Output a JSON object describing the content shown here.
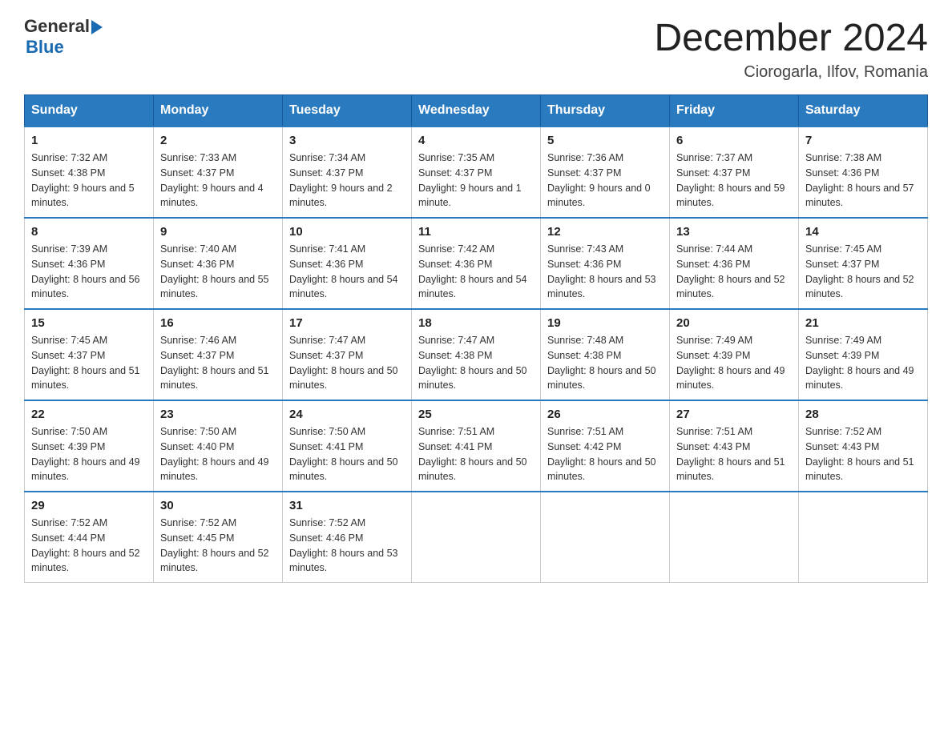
{
  "header": {
    "logo_general": "General",
    "logo_blue": "Blue",
    "title": "December 2024",
    "location": "Ciorogarla, Ilfov, Romania"
  },
  "days_of_week": [
    "Sunday",
    "Monday",
    "Tuesday",
    "Wednesday",
    "Thursday",
    "Friday",
    "Saturday"
  ],
  "weeks": [
    [
      {
        "day": "1",
        "sunrise": "7:32 AM",
        "sunset": "4:38 PM",
        "daylight": "9 hours and 5 minutes."
      },
      {
        "day": "2",
        "sunrise": "7:33 AM",
        "sunset": "4:37 PM",
        "daylight": "9 hours and 4 minutes."
      },
      {
        "day": "3",
        "sunrise": "7:34 AM",
        "sunset": "4:37 PM",
        "daylight": "9 hours and 2 minutes."
      },
      {
        "day": "4",
        "sunrise": "7:35 AM",
        "sunset": "4:37 PM",
        "daylight": "9 hours and 1 minute."
      },
      {
        "day": "5",
        "sunrise": "7:36 AM",
        "sunset": "4:37 PM",
        "daylight": "9 hours and 0 minutes."
      },
      {
        "day": "6",
        "sunrise": "7:37 AM",
        "sunset": "4:37 PM",
        "daylight": "8 hours and 59 minutes."
      },
      {
        "day": "7",
        "sunrise": "7:38 AM",
        "sunset": "4:36 PM",
        "daylight": "8 hours and 57 minutes."
      }
    ],
    [
      {
        "day": "8",
        "sunrise": "7:39 AM",
        "sunset": "4:36 PM",
        "daylight": "8 hours and 56 minutes."
      },
      {
        "day": "9",
        "sunrise": "7:40 AM",
        "sunset": "4:36 PM",
        "daylight": "8 hours and 55 minutes."
      },
      {
        "day": "10",
        "sunrise": "7:41 AM",
        "sunset": "4:36 PM",
        "daylight": "8 hours and 54 minutes."
      },
      {
        "day": "11",
        "sunrise": "7:42 AM",
        "sunset": "4:36 PM",
        "daylight": "8 hours and 54 minutes."
      },
      {
        "day": "12",
        "sunrise": "7:43 AM",
        "sunset": "4:36 PM",
        "daylight": "8 hours and 53 minutes."
      },
      {
        "day": "13",
        "sunrise": "7:44 AM",
        "sunset": "4:36 PM",
        "daylight": "8 hours and 52 minutes."
      },
      {
        "day": "14",
        "sunrise": "7:45 AM",
        "sunset": "4:37 PM",
        "daylight": "8 hours and 52 minutes."
      }
    ],
    [
      {
        "day": "15",
        "sunrise": "7:45 AM",
        "sunset": "4:37 PM",
        "daylight": "8 hours and 51 minutes."
      },
      {
        "day": "16",
        "sunrise": "7:46 AM",
        "sunset": "4:37 PM",
        "daylight": "8 hours and 51 minutes."
      },
      {
        "day": "17",
        "sunrise": "7:47 AM",
        "sunset": "4:37 PM",
        "daylight": "8 hours and 50 minutes."
      },
      {
        "day": "18",
        "sunrise": "7:47 AM",
        "sunset": "4:38 PM",
        "daylight": "8 hours and 50 minutes."
      },
      {
        "day": "19",
        "sunrise": "7:48 AM",
        "sunset": "4:38 PM",
        "daylight": "8 hours and 50 minutes."
      },
      {
        "day": "20",
        "sunrise": "7:49 AM",
        "sunset": "4:39 PM",
        "daylight": "8 hours and 49 minutes."
      },
      {
        "day": "21",
        "sunrise": "7:49 AM",
        "sunset": "4:39 PM",
        "daylight": "8 hours and 49 minutes."
      }
    ],
    [
      {
        "day": "22",
        "sunrise": "7:50 AM",
        "sunset": "4:39 PM",
        "daylight": "8 hours and 49 minutes."
      },
      {
        "day": "23",
        "sunrise": "7:50 AM",
        "sunset": "4:40 PM",
        "daylight": "8 hours and 49 minutes."
      },
      {
        "day": "24",
        "sunrise": "7:50 AM",
        "sunset": "4:41 PM",
        "daylight": "8 hours and 50 minutes."
      },
      {
        "day": "25",
        "sunrise": "7:51 AM",
        "sunset": "4:41 PM",
        "daylight": "8 hours and 50 minutes."
      },
      {
        "day": "26",
        "sunrise": "7:51 AM",
        "sunset": "4:42 PM",
        "daylight": "8 hours and 50 minutes."
      },
      {
        "day": "27",
        "sunrise": "7:51 AM",
        "sunset": "4:43 PM",
        "daylight": "8 hours and 51 minutes."
      },
      {
        "day": "28",
        "sunrise": "7:52 AM",
        "sunset": "4:43 PM",
        "daylight": "8 hours and 51 minutes."
      }
    ],
    [
      {
        "day": "29",
        "sunrise": "7:52 AM",
        "sunset": "4:44 PM",
        "daylight": "8 hours and 52 minutes."
      },
      {
        "day": "30",
        "sunrise": "7:52 AM",
        "sunset": "4:45 PM",
        "daylight": "8 hours and 52 minutes."
      },
      {
        "day": "31",
        "sunrise": "7:52 AM",
        "sunset": "4:46 PM",
        "daylight": "8 hours and 53 minutes."
      },
      null,
      null,
      null,
      null
    ]
  ],
  "labels": {
    "sunrise": "Sunrise:",
    "sunset": "Sunset:",
    "daylight": "Daylight:"
  }
}
